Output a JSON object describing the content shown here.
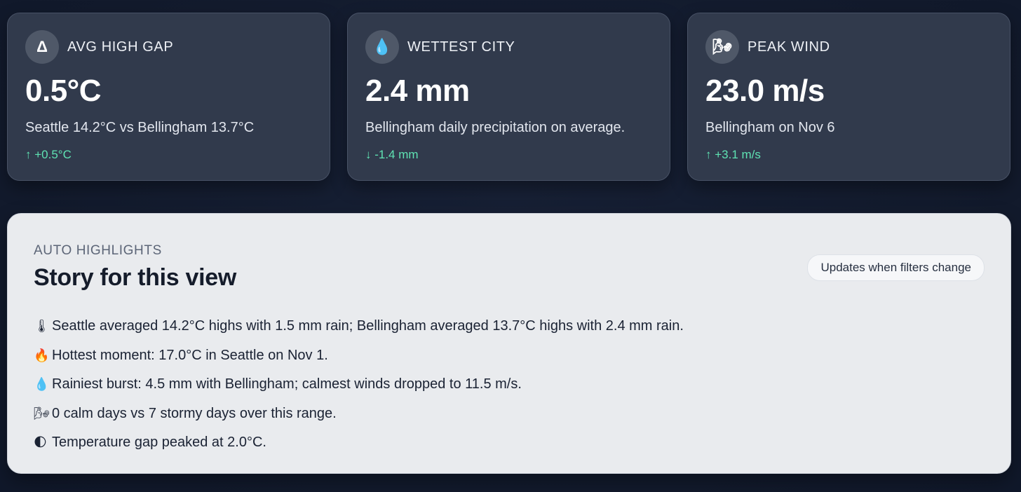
{
  "cards": [
    {
      "icon": "delta-icon",
      "icon_glyph": "Δ",
      "label": "AVG HIGH GAP",
      "value": "0.5°C",
      "description": "Seattle 14.2°C vs Bellingham 13.7°C",
      "delta": "↑ +0.5°C"
    },
    {
      "icon": "droplet-icon",
      "icon_glyph": "💧",
      "label": "WETTEST CITY",
      "value": "2.4 mm",
      "description": "Bellingham daily precipitation on average.",
      "delta": "↓ -1.4 mm"
    },
    {
      "icon": "wind-icon",
      "icon_glyph": "🌬",
      "label": "PEAK WIND",
      "value": "23.0 m/s",
      "description": "Bellingham on Nov 6",
      "delta": "↑ +3.1 m/s"
    }
  ],
  "highlights_panel": {
    "eyebrow": "AUTO HIGHLIGHTS",
    "title": "Story for this view",
    "chip": "Updates when filters change",
    "items": [
      {
        "icon": "thermometer-icon",
        "glyph": "🌡",
        "text": "Seattle averaged 14.2°C highs with 1.5 mm rain; Bellingham averaged 13.7°C highs with 2.4 mm rain."
      },
      {
        "icon": "fire-icon",
        "glyph": "🔥",
        "text": "Hottest moment: 17.0°C in Seattle on Nov 1."
      },
      {
        "icon": "droplet-icon",
        "glyph": "💧",
        "text": "Rainiest burst: 4.5 mm with Bellingham; calmest winds dropped to 11.5 m/s."
      },
      {
        "icon": "wind-icon",
        "glyph": "🌬",
        "text": "0 calm days vs 7 stormy days over this range."
      },
      {
        "icon": "half-moon-icon",
        "glyph": "🌓",
        "text": "Temperature gap peaked at 2.0°C."
      }
    ]
  },
  "colors": {
    "background": "#131b2e",
    "card": "#313a4c",
    "accent_delta": "#5fe3b3",
    "panel": "#e9ebee"
  }
}
